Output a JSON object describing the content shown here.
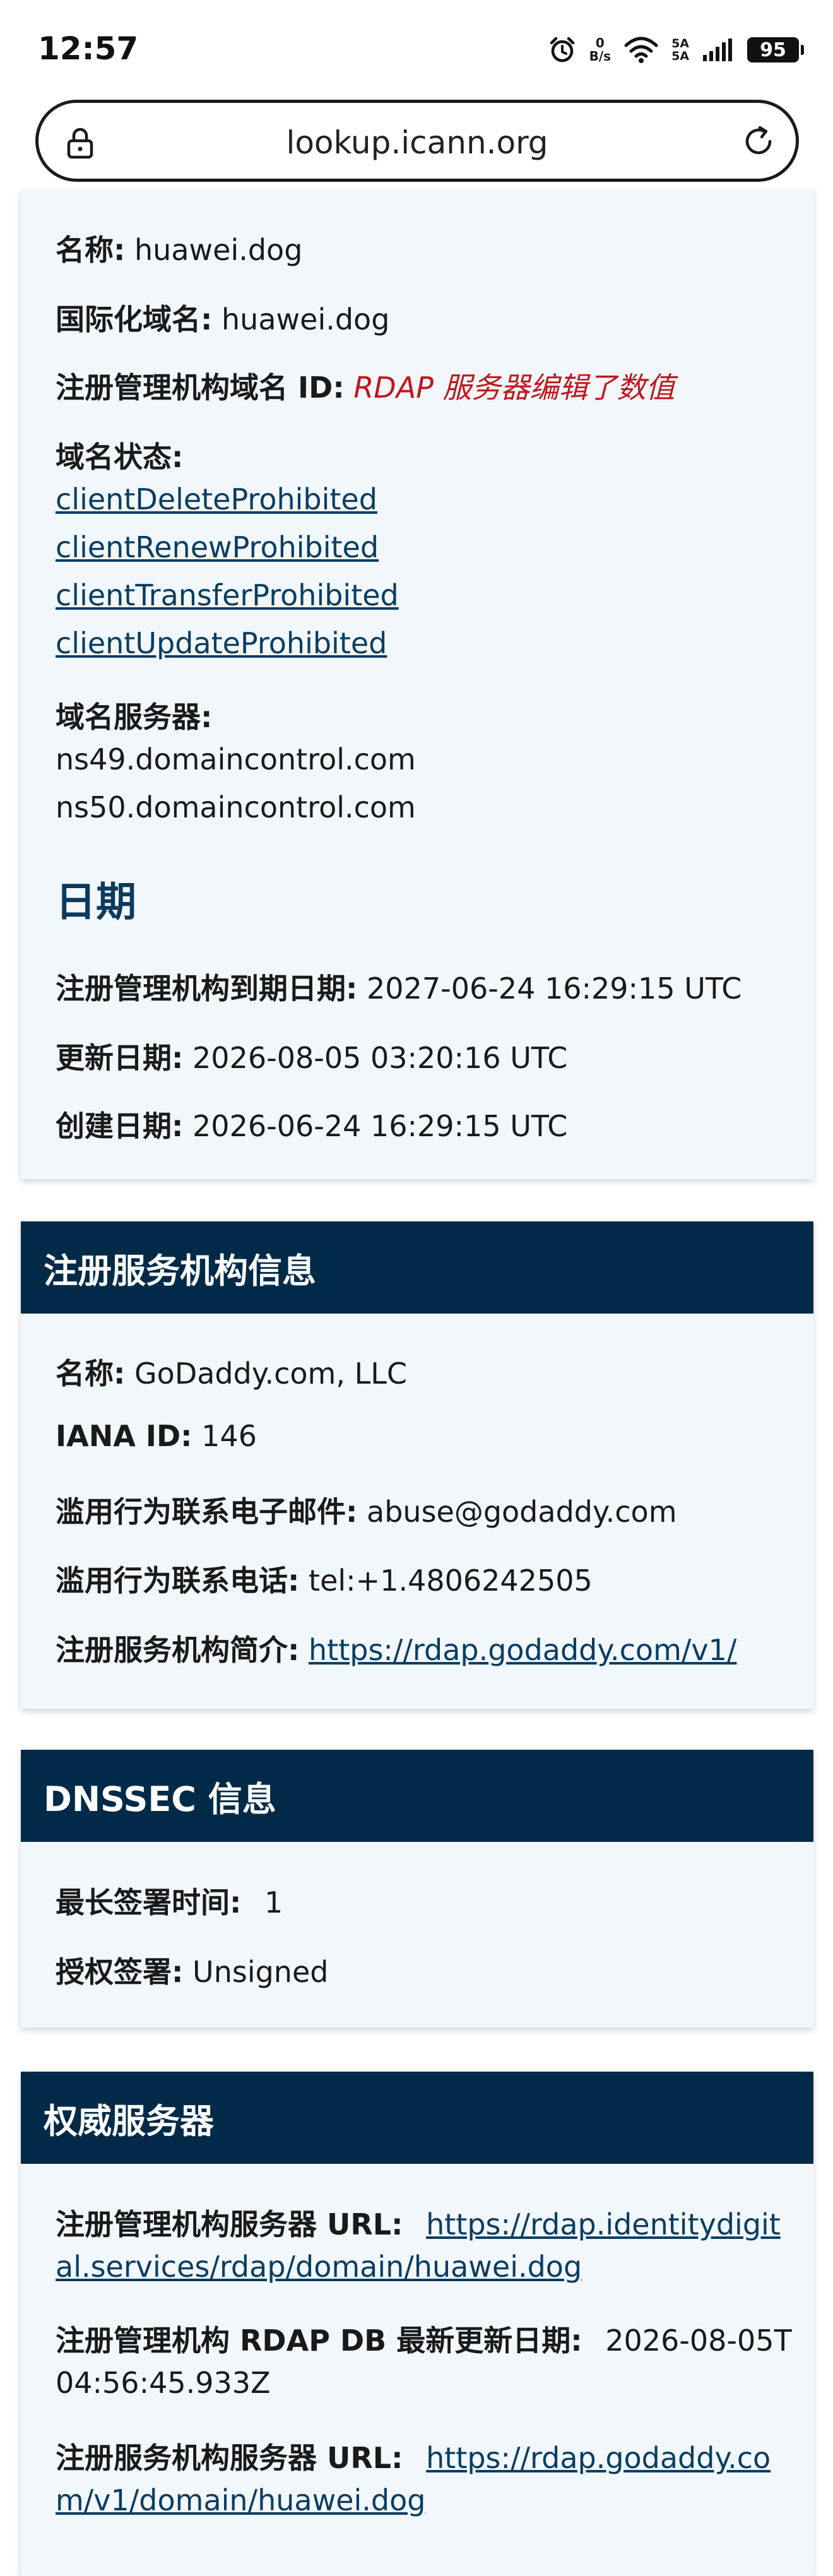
{
  "status_bar": {
    "time": "12:57",
    "speed_value": "0",
    "speed_unit": "B/s",
    "net_top": "5A",
    "net_bottom": "5A",
    "battery": "95",
    "icons": [
      "alarm-icon",
      "wifi-icon",
      "signal-icon",
      "battery-icon"
    ]
  },
  "url_bar": {
    "url": "lookup.icann.org"
  },
  "domain": {
    "name_label": "名称:",
    "name_value": "huawei.dog",
    "idn_label": "国际化域名:",
    "idn_value": "huawei.dog",
    "registry_id_label": "注册管理机构域名 ID:",
    "registry_id_value": "RDAP 服务器编辑了数值",
    "status_label": "域名状态:",
    "statuses": [
      "clientDeleteProhibited",
      "clientRenewProhibited",
      "clientTransferProhibited",
      "clientUpdateProhibited"
    ],
    "ns_label": "域名服务器:",
    "nameservers": [
      "ns49.domaincontrol.com",
      "ns50.domaincontrol.com"
    ],
    "dates_title": "日期",
    "expiry_label": "注册管理机构到期日期:",
    "expiry_value": "2027-06-24 16:29:15 UTC",
    "updated_label": "更新日期:",
    "updated_value": "2026-08-05 03:20:16 UTC",
    "created_label": "创建日期:",
    "created_value": "2026-06-24 16:29:15 UTC"
  },
  "registrar": {
    "title": "注册服务机构信息",
    "name_label": "名称:",
    "name_value": "GoDaddy.com, LLC",
    "iana_label": "IANA ID:",
    "iana_value": "146",
    "email_label": "滥用行为联系电子邮件:",
    "email_value": "abuse@godaddy.com",
    "phone_label": "滥用行为联系电话:",
    "phone_value": "tel:+1.4806242505",
    "profile_label": "注册服务机构简介:",
    "profile_value": "https://rdap.godaddy.com/v1/"
  },
  "dnssec": {
    "title": "DNSSEC 信息",
    "max_sig_label": "最长签署时间:",
    "max_sig_value": "1",
    "delegation_label": "授权签署:",
    "delegation_value": "Unsigned"
  },
  "authority": {
    "title": "权威服务器",
    "registry_url_label": "注册管理机构服务器 URL:",
    "registry_url_line1": "https://rdap.identitydigit",
    "registry_url_line2": "al.services/rdap/domain/huawei.dog",
    "rdap_update_label": "注册管理机构 RDAP DB 最新更新日期:",
    "rdap_update_line1": "2026-08-05T",
    "rdap_update_line2": "04:56:45.933Z",
    "registrar_url_label": "注册服务机构服务器 URL:",
    "registrar_url_line1": "https://rdap.godaddy.co",
    "registrar_url_line2": "m/v1/domain/huawei.dog"
  }
}
